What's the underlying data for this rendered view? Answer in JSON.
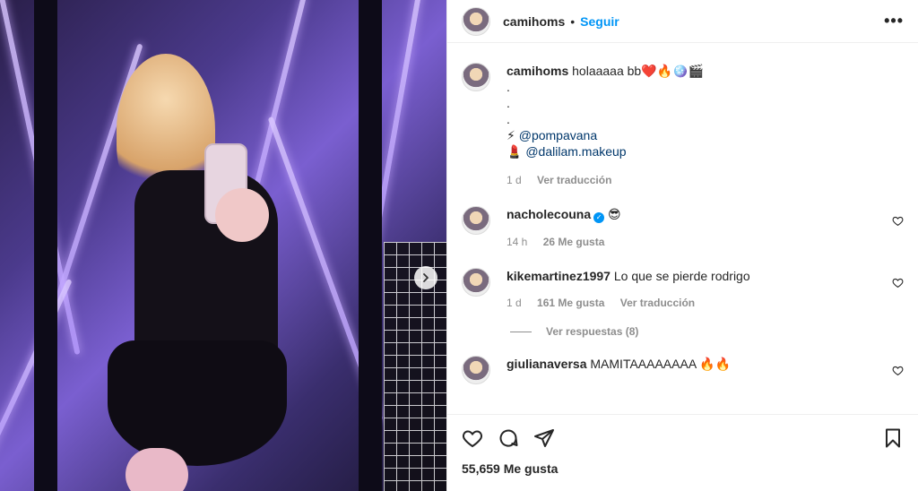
{
  "post": {
    "username": "camihoms",
    "follow_label": "Seguir",
    "more_label": "•••",
    "caption": {
      "username": "camihoms",
      "text": "holaaaaa bb❤️🔥🪩🎬",
      "dots": [
        ".",
        ".",
        "."
      ],
      "credits": [
        {
          "emoji": "⚡",
          "mention": "@pompavana"
        },
        {
          "emoji": "💄",
          "mention": "@dalilam.makeup"
        }
      ],
      "time": "1 d",
      "translate": "Ver traducción"
    },
    "comments": [
      {
        "username": "nacholecouna",
        "verified": true,
        "text": "😎",
        "time": "14 h",
        "likes": "26 Me gusta",
        "translate": ""
      },
      {
        "username": "kikemartinez1997",
        "verified": false,
        "text": "Lo que se pierde rodrigo",
        "time": "1 d",
        "likes": "161 Me gusta",
        "translate": "Ver traducción",
        "replies": "Ver respuestas (8)"
      },
      {
        "username": "giulianaversa",
        "verified": false,
        "text": "MAMITAAAAAAAA 🔥🔥",
        "time": "",
        "likes": "",
        "translate": ""
      }
    ],
    "likes_count": "55,659 Me gusta",
    "icons": [
      "heart-icon",
      "comment-icon",
      "share-icon",
      "bookmark-icon",
      "chevron-right-icon"
    ]
  }
}
